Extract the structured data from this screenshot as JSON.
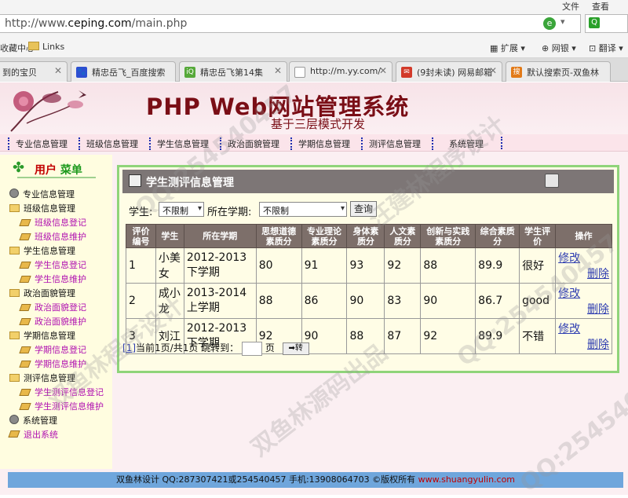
{
  "browser": {
    "menu": [
      "文件",
      "查看"
    ],
    "url_prefix": "http://www.",
    "url_host": "ceping.com",
    "url_path": "/main.php",
    "bookmarks": [
      "收藏中心",
      "Links"
    ],
    "right_tools": [
      "扩展",
      "网银",
      "翻译"
    ],
    "tabs": [
      {
        "label": "到的宝贝",
        "icon": "page-icon"
      },
      {
        "label": "精忠岳飞_百度搜索",
        "icon": "baidu-icon"
      },
      {
        "label": "精忠岳飞第14集",
        "icon": "iqiyi-icon"
      },
      {
        "label": "http://m.yy.com/",
        "icon": "page-icon"
      },
      {
        "label": "(9封未读) 网易邮箱",
        "icon": "mail-icon"
      },
      {
        "label": "默认搜索页-双鱼林",
        "icon": "search-icon"
      }
    ]
  },
  "site": {
    "title": "PHP Web网站管理系统",
    "subtitle": "基于三层模式开发",
    "nav": [
      "专业信息管理",
      "班级信息管理",
      "学生信息管理",
      "政治面貌管理",
      "学期信息管理",
      "测评信息管理",
      "系统管理"
    ]
  },
  "sidebar": {
    "title_red": "用户",
    "title_green": "菜单",
    "groups": [
      {
        "label": "专业信息管理",
        "items": []
      },
      {
        "label": "班级信息管理",
        "items": [
          "班级信息登记",
          "班级信息维护"
        ]
      },
      {
        "label": "学生信息管理",
        "items": [
          "学生信息登记",
          "学生信息维护"
        ]
      },
      {
        "label": "政治面貌管理",
        "items": [
          "政治面貌登记",
          "政治面貌维护"
        ]
      },
      {
        "label": "学期信息管理",
        "items": [
          "学期信息登记",
          "学期信息维护"
        ]
      },
      {
        "label": "测评信息管理",
        "items": [
          "学生测评信息登记",
          "学生测评信息维护"
        ]
      },
      {
        "label": "系统管理",
        "items": []
      },
      {
        "label": "退出系统",
        "items": []
      }
    ]
  },
  "main": {
    "title": "学生测评信息管理",
    "filter": {
      "student_label": "学生:",
      "student_value": "不限制",
      "term_label": "所在学期:",
      "term_value": "不限制",
      "query_button": "查询"
    },
    "columns": [
      "评价编号",
      "学生",
      "所在学期",
      "思想道德素质分",
      "专业理论素质分",
      "身体素质分",
      "人文素质分",
      "创新与实践素质分",
      "综合素质分",
      "学生评价",
      "操作"
    ],
    "rows": [
      {
        "id": "1",
        "student": "小美女",
        "term": "2012-2013下学期",
        "moral": "80",
        "theory": "91",
        "body": "93",
        "humanities": "92",
        "innovation": "88",
        "total": "89.9",
        "comment": "很好"
      },
      {
        "id": "2",
        "student": "成小龙",
        "term": "2013-2014上学期",
        "moral": "88",
        "theory": "86",
        "body": "90",
        "humanities": "83",
        "innovation": "90",
        "total": "86.7",
        "comment": "good"
      },
      {
        "id": "3",
        "student": "刘江",
        "term": "2012-2013下学期",
        "moral": "92",
        "theory": "90",
        "body": "88",
        "humanities": "87",
        "innovation": "92",
        "total": "89.9",
        "comment": "不错"
      }
    ],
    "actions": {
      "edit": "修改",
      "delete": "删除"
    },
    "pager": {
      "page_link": "1",
      "text": "当前1页/共1页 跳转到：",
      "suffix": "页",
      "go_button": "➡转"
    }
  },
  "footer": {
    "text": "双鱼林设计  QQ:287307421或254540457 手机:13908064703 ©版权所有 ",
    "url": "www.shuangyulin.com"
  },
  "watermarks": [
    "QQ:254540457",
    "双鱼林源码出品",
    "汪建林程序设计",
    "QQ:254540457",
    "双鱼林程序设计",
    "QQ:254540457"
  ]
}
